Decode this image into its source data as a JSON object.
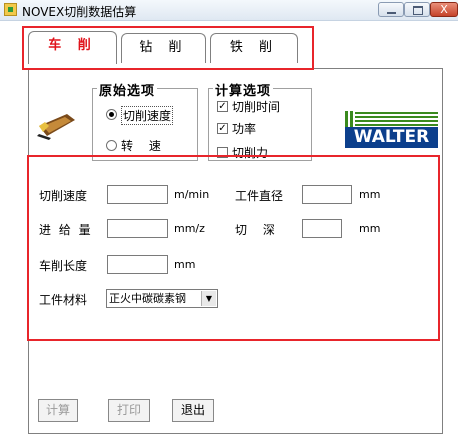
{
  "window": {
    "title": "NOVEX切削数据估算",
    "close_glyph": "X"
  },
  "tabs": [
    {
      "label": "车 削",
      "active": true
    },
    {
      "label": "钻 削",
      "active": false
    },
    {
      "label": "铁 削",
      "active": false
    }
  ],
  "origin_options": {
    "title": "原始选项",
    "items": [
      {
        "label": "切削速度",
        "selected": true
      },
      {
        "label": "转　 速",
        "selected": false
      }
    ]
  },
  "calc_options": {
    "title": "计算选项",
    "items": [
      {
        "label": "切削时间",
        "checked": true
      },
      {
        "label": "功率",
        "checked": true
      },
      {
        "label": "切削力",
        "checked": false
      }
    ]
  },
  "logo": {
    "text": "WALTER",
    "color": "#0c3f8c"
  },
  "fields": {
    "cutting_speed": {
      "label": "切削速度",
      "value": "",
      "unit": "m/min"
    },
    "workpiece_diameter": {
      "label": "工件直径",
      "value": "",
      "unit": "mm"
    },
    "feed": {
      "label": "进 给 量",
      "value": "",
      "unit": "mm/z"
    },
    "depth": {
      "label": "切　 深",
      "value": "",
      "unit": "mm"
    },
    "turning_length": {
      "label": "车削长度",
      "value": "",
      "unit": "mm"
    },
    "material": {
      "label": "工件材料",
      "value": "正火中碳碳素钢"
    }
  },
  "buttons": {
    "calculate": "计算",
    "print": "打印",
    "exit": "退出"
  },
  "colors": {
    "accent_red": "#e8252b",
    "tab_active_text": "#e0131b"
  }
}
